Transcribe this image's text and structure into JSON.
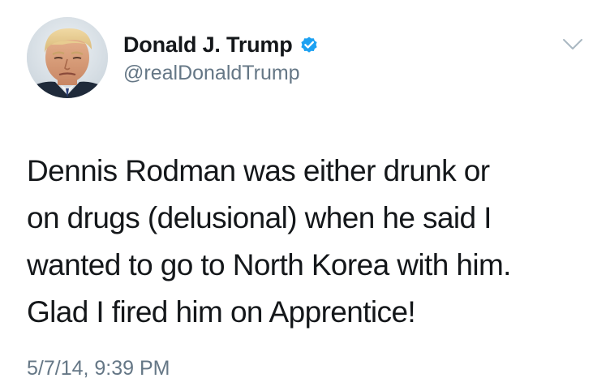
{
  "tweet": {
    "display_name": "Donald J. Trump",
    "handle": "@realDonaldTrump",
    "verified_icon": "verified-badge-icon",
    "menu_icon": "chevron-down-icon",
    "avatar_icon": "avatar",
    "body_lines": [
      "Dennis Rodman was either drunk or",
      "on drugs (delusional) when he said I",
      "wanted to go to North Korea with him.",
      "Glad I fired him on Apprentice!"
    ],
    "timestamp": "5/7/14, 9:39 PM"
  },
  "colors": {
    "text_primary": "#14171a",
    "text_secondary": "#657786",
    "verified_blue": "#1da1f2",
    "chevron": "#aab8c2",
    "background": "#ffffff"
  }
}
